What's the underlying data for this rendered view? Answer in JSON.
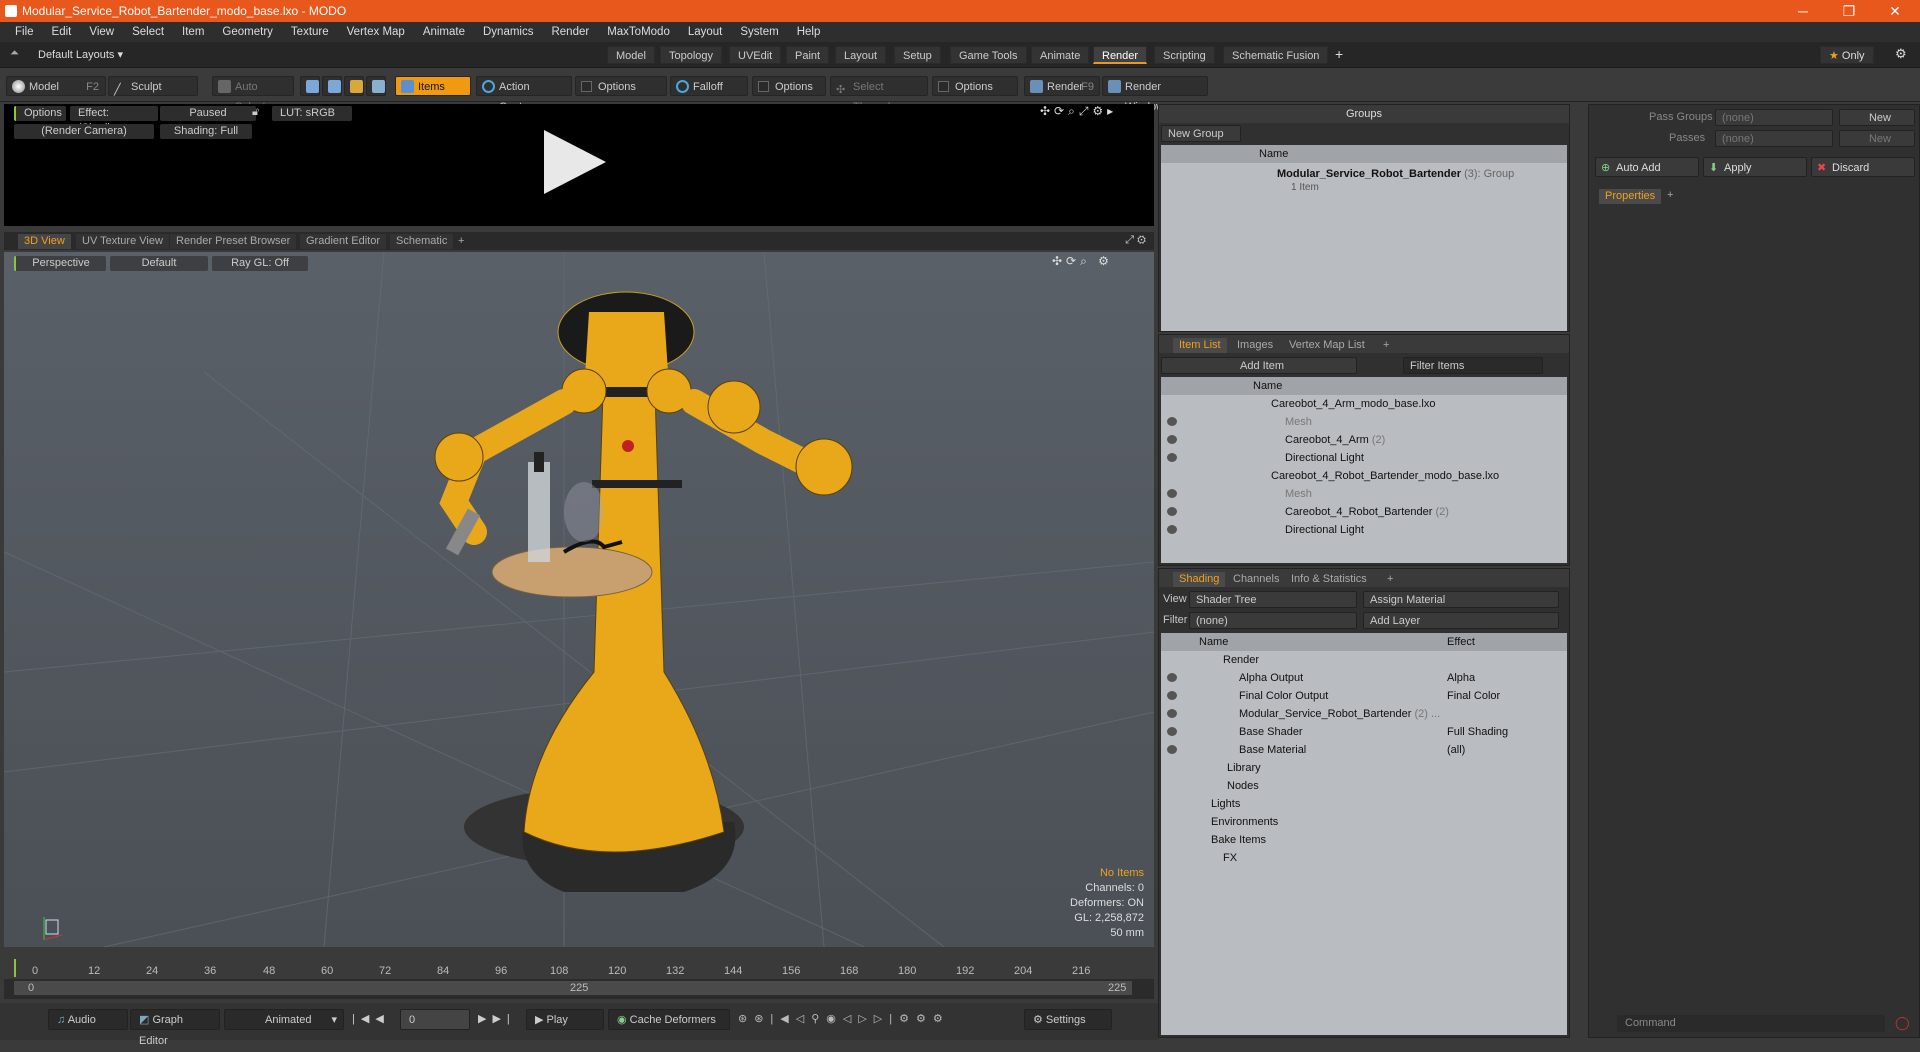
{
  "window": {
    "title": "Modular_Service_Robot_Bartender_modo_base.lxo - MODO",
    "controls": [
      "─",
      "❐",
      "✕"
    ]
  },
  "menu": [
    "File",
    "Edit",
    "View",
    "Select",
    "Item",
    "Geometry",
    "Texture",
    "Vertex Map",
    "Animate",
    "Dynamics",
    "Render",
    "MaxToModo",
    "Layout",
    "System",
    "Help"
  ],
  "layouts": {
    "dropdown": "Default Layouts ▾",
    "tabs": [
      "Model",
      "Topology",
      "UVEdit",
      "Paint",
      "Layout",
      "Setup",
      "Game Tools",
      "Animate",
      "Render",
      "Scripting",
      "Schematic Fusion"
    ],
    "active": "Render",
    "only": "Only"
  },
  "toolbar": {
    "model": "Model",
    "model_key": "F2",
    "sculpt": "Sculpt",
    "auto_select": "Auto Select",
    "items": "Items",
    "action_center": "Action Center",
    "options": "Options",
    "falloff": "Falloff",
    "select_through": "Select Through",
    "render": "Render",
    "render_key": "F9",
    "render_window": "Render Window"
  },
  "preview": {
    "options": "Options",
    "effect": "Effect: (Shadi...",
    "paused": "Paused",
    "lut": "LUT: sRGB",
    "camera": "(Render Camera)",
    "shading": "Shading: Full"
  },
  "viewport_tabs": [
    "3D View",
    "UV Texture View",
    "Render Preset Browser",
    "Gradient Editor",
    "Schematic",
    "+"
  ],
  "viewport": {
    "perspective": "Perspective",
    "default": "Default",
    "raygl": "Ray GL: Off",
    "stats": {
      "no_items": "No Items",
      "channels": "Channels: 0",
      "deformers": "Deformers: ON",
      "gl": "GL: 2,258,872",
      "focal": "50 mm"
    }
  },
  "timeline": {
    "ticks": [
      "0",
      "12",
      "24",
      "36",
      "48",
      "60",
      "72",
      "84",
      "96",
      "108",
      "120",
      "132",
      "144",
      "156",
      "168",
      "180",
      "192",
      "204",
      "216"
    ],
    "end_top": "225",
    "start_bot": "0",
    "mid_bot": "225",
    "end_bot": "225"
  },
  "bottom": {
    "audio": "Audio",
    "graph_editor": "Graph Editor",
    "animated": "Animated",
    "frame": "0",
    "play": "Play",
    "cache": "Cache Deformers",
    "settings": "Settings"
  },
  "groups": {
    "title": "Groups",
    "new_group": "New Group",
    "col_name": "Name",
    "item_name": "Modular_Service_Robot_Bartender",
    "item_count": "(3)",
    "item_type": ": Group",
    "item_sub": "1 Item"
  },
  "itemlist": {
    "tabs": [
      "Item List",
      "Images",
      "Vertex Map List",
      "+"
    ],
    "add_item": "Add Item",
    "filter": "Filter Items",
    "col_name": "Name",
    "rows": [
      {
        "label": "Careobot_4_Arm_modo_base.lxo",
        "indent": 0,
        "dim": false
      },
      {
        "label": "Mesh",
        "indent": 1,
        "dim": true
      },
      {
        "label": "Careobot_4_Arm",
        "suffix": "(2)",
        "indent": 1,
        "dim": false
      },
      {
        "label": "Directional Light",
        "indent": 1,
        "dim": false
      },
      {
        "label": "Careobot_4_Robot_Bartender_modo_base.lxo",
        "indent": 0,
        "dim": false
      },
      {
        "label": "Mesh",
        "indent": 1,
        "dim": true
      },
      {
        "label": "Careobot_4_Robot_Bartender",
        "suffix": "(2)",
        "indent": 1,
        "dim": false
      },
      {
        "label": "Directional Light",
        "indent": 1,
        "dim": false
      }
    ]
  },
  "shading": {
    "tabs": [
      "Shading",
      "Channels",
      "Info & Statistics",
      "+"
    ],
    "view_label": "View",
    "view_value": "Shader Tree",
    "assign": "Assign Material",
    "filter_label": "Filter",
    "filter_value": "(none)",
    "add_layer": "Add Layer",
    "col_name": "Name",
    "col_effect": "Effect",
    "rows": [
      {
        "label": "Render",
        "effect": ""
      },
      {
        "label": "Alpha Output",
        "effect": "Alpha"
      },
      {
        "label": "Final Color Output",
        "effect": "Final Color"
      },
      {
        "label": "Modular_Service_Robot_Bartender",
        "suffix": "(2) ...",
        "effect": ""
      },
      {
        "label": "Base Shader",
        "effect": "Full Shading"
      },
      {
        "label": "Base Material",
        "effect": "(all)"
      },
      {
        "label": "Library",
        "effect": ""
      },
      {
        "label": "Nodes",
        "effect": ""
      },
      {
        "label": "Lights",
        "effect": ""
      },
      {
        "label": "Environments",
        "effect": ""
      },
      {
        "label": "Bake Items",
        "effect": ""
      },
      {
        "label": "FX",
        "effect": ""
      }
    ]
  },
  "passes": {
    "pass_groups": "Pass Groups",
    "passes": "Passes",
    "none": "(none)",
    "new": "New",
    "auto_add": "Auto Add",
    "apply": "Apply",
    "discard": "Discard",
    "properties": "Properties",
    "command": "Command"
  }
}
